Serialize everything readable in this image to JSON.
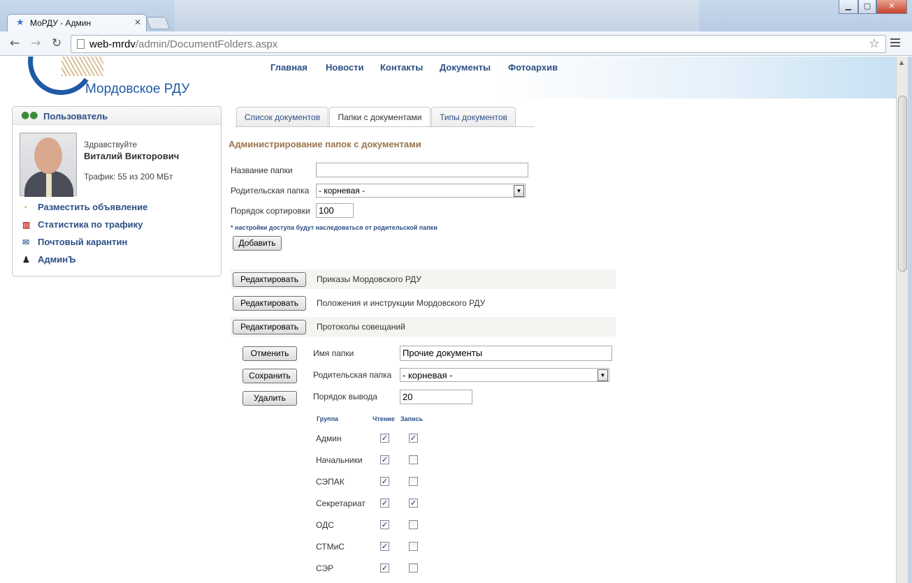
{
  "browser": {
    "tab_title": "МоРДУ - Админ",
    "url_host": "web-mrdv",
    "url_path": "/admin/DocumentFolders.aspx"
  },
  "site": {
    "logo_text": "Мордовское РДУ",
    "nav": [
      "Главная",
      "Новости",
      "Контакты",
      "Документы",
      "Фотоархив"
    ]
  },
  "user_panel": {
    "title": "Пользователь",
    "greeting": "Здравствуйте",
    "name": "Виталий Викторович",
    "traffic": "Трафик: 55 из 200 МБт",
    "links": [
      "Разместить объявление",
      "Статистика по трафику",
      "Почтовый карантин",
      "АдминЪ"
    ]
  },
  "tabs": [
    "Список документов",
    "Папки с документами",
    "Типы документов"
  ],
  "active_tab": "Папки с документами",
  "admin": {
    "title": "Администрирование папок с документами",
    "name_label": "Название папки",
    "name_value": "",
    "parent_label": "Родительская папка",
    "parent_value": "- корневая -",
    "sort_label": "Порядок сортировки",
    "sort_value": "100",
    "note": "* настройки доступа будут наследоваться от родительской папки",
    "add_button": "Добавить"
  },
  "folders": [
    {
      "edit": "Редактировать",
      "name": "Приказы Мордовского РДУ"
    },
    {
      "edit": "Редактировать",
      "name": "Положения и инструкции Мордовского РДУ"
    },
    {
      "edit": "Редактировать",
      "name": "Протоколы совещаний"
    }
  ],
  "edit_form": {
    "cancel": "Отменить",
    "save": "Сохранить",
    "delete": "Удалить",
    "name_label": "Имя папки",
    "name_value": "Прочие документы",
    "parent_label": "Родительская папка",
    "parent_value": "- корневая -",
    "order_label": "Порядок вывода",
    "order_value": "20",
    "col_group": "Группа",
    "col_read": "Чтение",
    "col_write": "Запись",
    "groups": [
      {
        "name": "Админ",
        "read": true,
        "write": true
      },
      {
        "name": "Начальники",
        "read": true,
        "write": false
      },
      {
        "name": "СЭПАК",
        "read": true,
        "write": false
      },
      {
        "name": "Секретариат",
        "read": true,
        "write": true
      },
      {
        "name": "ОДС",
        "read": true,
        "write": false
      },
      {
        "name": "СТМиС",
        "read": true,
        "write": false
      },
      {
        "name": "СЭР",
        "read": true,
        "write": false
      }
    ]
  },
  "colors": {
    "link": "#2d4f86",
    "title": "#9a7348",
    "logo": "#1f5aa6"
  }
}
